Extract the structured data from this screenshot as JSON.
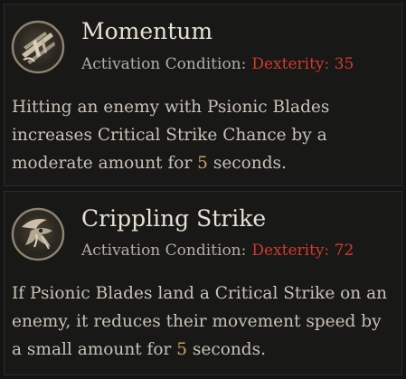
{
  "skills": [
    {
      "name": "Momentum",
      "icon": "momentum-icon",
      "condition_label": "Activation Condition:",
      "condition_value": "Dexterity: 35",
      "description": {
        "line1": "Hitting an enemy with Psionic Blades",
        "line2": "increases Critical Strike Chance by a",
        "line3_pre": "moderate amount for ",
        "duration": "5",
        "line3_post": " seconds."
      }
    },
    {
      "name": "Crippling Strike",
      "icon": "crippling-strike-icon",
      "condition_label": "Activation Condition:",
      "condition_value": "Dexterity: 72",
      "description": {
        "line1": "If Psionic Blades land a Critical Strike on an",
        "line2": "enemy, it reduces their movement speed by",
        "line3_pre": "a small amount for ",
        "duration": "5",
        "line3_post": " seconds."
      }
    }
  ],
  "colors": {
    "background": "#141414",
    "panel": "#181817",
    "title": "#e7e1d3",
    "label": "#b5aea1",
    "requirement": "#cf3a2c",
    "number_highlight": "#c9a566",
    "body_text": "#c8c2b5"
  }
}
